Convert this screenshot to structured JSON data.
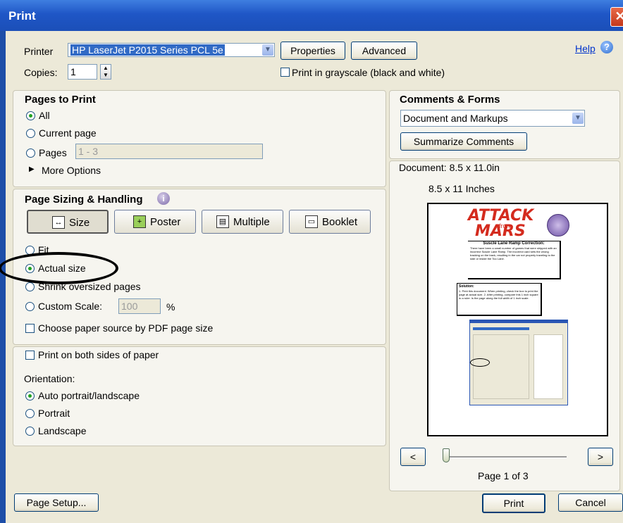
{
  "window": {
    "title": "Print",
    "close_glyph": "✕"
  },
  "printer": {
    "label": "Printer",
    "selected": "HP LaserJet P2015 Series PCL 5e",
    "properties_label": "Properties",
    "advanced_label": "Advanced",
    "help_label": "Help"
  },
  "copies": {
    "label": "Copies:",
    "value": "1",
    "grayscale_label": "Print in grayscale (black and white)",
    "grayscale_checked": false
  },
  "pages_to_print": {
    "header": "Pages to Print",
    "all": "All",
    "current": "Current page",
    "pages": "Pages",
    "pages_value": "1 - 3",
    "more_options": "More Options"
  },
  "sizing": {
    "header": "Page Sizing & Handling",
    "info_icon": "info-icon",
    "modes": [
      "Size",
      "Poster",
      "Multiple",
      "Booklet"
    ],
    "selected_mode": "Size",
    "fit_label": "Fit",
    "actual_size": "Actual size",
    "shrink": "Shrink oversized pages",
    "custom_scale": "Custom Scale:",
    "custom_value": "100",
    "percent": "%",
    "paper_source": "Choose paper source by PDF page size"
  },
  "duplex": {
    "label": "Print on both sides of paper"
  },
  "orientation": {
    "label": "Orientation:",
    "auto": "Auto portrait/landscape",
    "portrait": "Portrait",
    "landscape": "Landscape"
  },
  "comments": {
    "header": "Comments & Forms",
    "selected": "Document and Markups",
    "summarize": "Summarize Comments"
  },
  "preview": {
    "doc_size": "Document: 8.5 x 11.0in",
    "paper_size": "8.5 x 11 Inches",
    "page_title_top": "ATTACK",
    "page_title_from": "from",
    "page_title_bottom": "MARS",
    "box1_title": "Suscle Lane Ramp Correction:",
    "box1_body": "There have been a small number of games that were shipped with an incorrect Suscle Lane Ramp. The incorrect card sets the wrong tracking on the track, resulting in the car not properly traveling to the side or inside the Too Lane.",
    "box2_title": "Solution:",
    "box2_body": "1. Print this document. When printing, check the box to print the page at actual size. 2. After printing, compare this 1 inch square to a ruler. Is the page along the full width of 1 inch scale.",
    "prev": "<",
    "next": ">",
    "page_status": "Page 1 of 3",
    "slider_fraction": 0.0
  },
  "footer": {
    "page_setup": "Page Setup...",
    "print": "Print",
    "cancel": "Cancel"
  },
  "colors": {
    "titlebar": "#1f56c6",
    "client_bg": "#ece9d8",
    "selection_bg": "#316ac5",
    "annotation_ellipse": "#000000"
  }
}
